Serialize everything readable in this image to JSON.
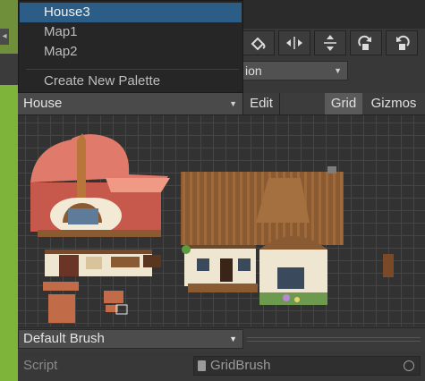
{
  "palette_menu": {
    "items": [
      "House3",
      "Map1",
      "Map2"
    ],
    "selected": "House3",
    "create_label": "Create New Palette"
  },
  "target": {
    "value": "ion"
  },
  "palette_toolbar": {
    "palette_name": "House",
    "edit_label": "Edit",
    "grid_label": "Grid",
    "gizmos_label": "Gizmos"
  },
  "tools": [
    {
      "icon": "fill-bucket-icon"
    },
    {
      "icon": "flip-horizontal-icon"
    },
    {
      "icon": "flip-vertical-icon"
    },
    {
      "icon": "rotate-clockwise-icon"
    },
    {
      "icon": "rotate-counterclockwise-icon"
    }
  ],
  "brush": {
    "selected": "Default Brush",
    "script_label": "Script",
    "script_value": "GridBrush"
  },
  "colors": {
    "menu_highlight": "#2c5d87",
    "roof_pink": "#e07a6a",
    "roof_brown": "#8a5a32",
    "wall_cream": "#efe6d2"
  }
}
